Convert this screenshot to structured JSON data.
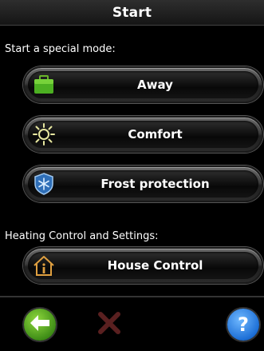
{
  "header": {
    "title": "Start"
  },
  "special_mode": {
    "label": "Start a special mode:",
    "buttons": [
      {
        "label": "Away",
        "icon": "suitcase-icon"
      },
      {
        "label": "Comfort",
        "icon": "sun-icon"
      },
      {
        "label": "Frost protection",
        "icon": "snowflake-shield-icon"
      }
    ]
  },
  "heating": {
    "label": "Heating Control and Settings:",
    "house_button": {
      "label": "House Control",
      "icon": "house-info-icon"
    }
  },
  "footer": {
    "back_icon": "back-arrow-icon",
    "cancel_icon": "cancel-x-icon",
    "help_text": "?"
  },
  "colors": {
    "accent_green": "#4caf22",
    "accent_blue": "#1d6fd6",
    "cancel_red": "#5a2020"
  }
}
